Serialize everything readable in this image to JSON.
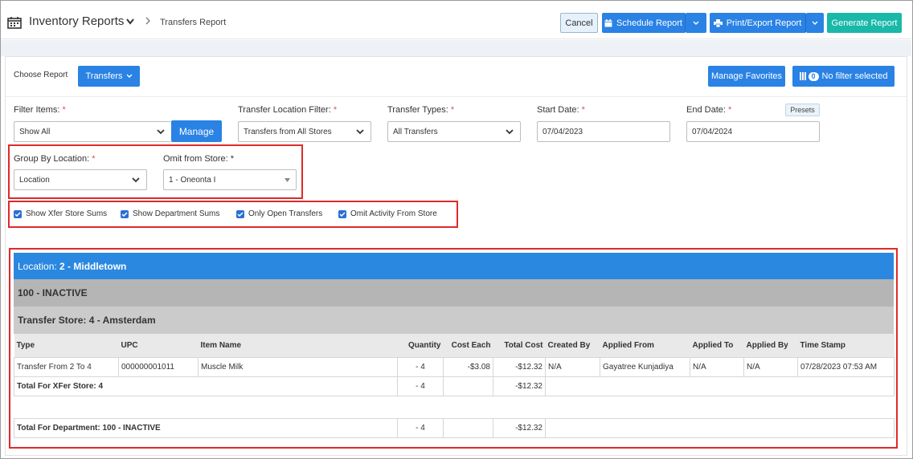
{
  "header": {
    "app_title": "Inventory Reports",
    "breadcrumb": "Transfers Report",
    "cancel_label": "Cancel",
    "schedule_label": "Schedule Report",
    "print_label": "Print/Export Report",
    "generate_label": "Generate Report"
  },
  "toolbar": {
    "choose_report_label": "Choose Report",
    "report_selected": "Transfers",
    "manage_favorites_label": "Manage Favorites",
    "filter_count": "0",
    "filter_label": "No filter selected"
  },
  "filters": {
    "filter_items_label": "Filter Items:",
    "filter_items_value": "Show All",
    "manage_label": "Manage",
    "transfer_location_label": "Transfer Location Filter:",
    "transfer_location_value": "Transfers from All Stores",
    "transfer_types_label": "Transfer Types:",
    "transfer_types_value": "All Transfers",
    "start_date_label": "Start Date:",
    "start_date_value": "07/04/2023",
    "end_date_label": "End Date:",
    "end_date_value": "07/04/2024",
    "presets_label": "Presets",
    "group_by_label": "Group By Location:",
    "group_by_value": "Location",
    "omit_store_label": "Omit from Store: *",
    "omit_store_value": "1 - Oneonta I",
    "required_mark": "*"
  },
  "checkboxes": [
    {
      "label": "Show Xfer Store Sums",
      "checked": true
    },
    {
      "label": "Show Department Sums",
      "checked": true
    },
    {
      "label": "Only Open Transfers",
      "checked": true
    },
    {
      "label": "Omit Activity From Store",
      "checked": true
    }
  ],
  "report": {
    "location_prefix": "Location:",
    "location_name": "2 - Middletown",
    "department": "100 - INACTIVE",
    "transfer_store": "Transfer Store: 4 - Amsterdam",
    "columns": [
      "Type",
      "UPC",
      "Item Name",
      "Quantity",
      "Cost Each",
      "Total Cost",
      "Created By",
      "Applied From",
      "Applied To",
      "Applied By",
      "Time Stamp"
    ],
    "row": {
      "type": "Transfer From 2 To 4",
      "upc": "000000001011",
      "item_name": "Muscle Milk",
      "quantity": "- 4",
      "cost_each": "-$3.08",
      "total_cost": "-$12.32",
      "created_by": "N/A",
      "applied_from": "Gayatree Kunjadiya",
      "applied_to": "N/A",
      "applied_by": "N/A",
      "time_stamp": "07/28/2023 07:53 AM"
    },
    "store_total": {
      "label": "Total For XFer Store: 4",
      "quantity": "- 4",
      "total_cost": "-$12.32"
    },
    "dept_total": {
      "label": "Total For Department: 100 - INACTIVE",
      "quantity": "- 4",
      "total_cost": "-$12.32"
    }
  }
}
